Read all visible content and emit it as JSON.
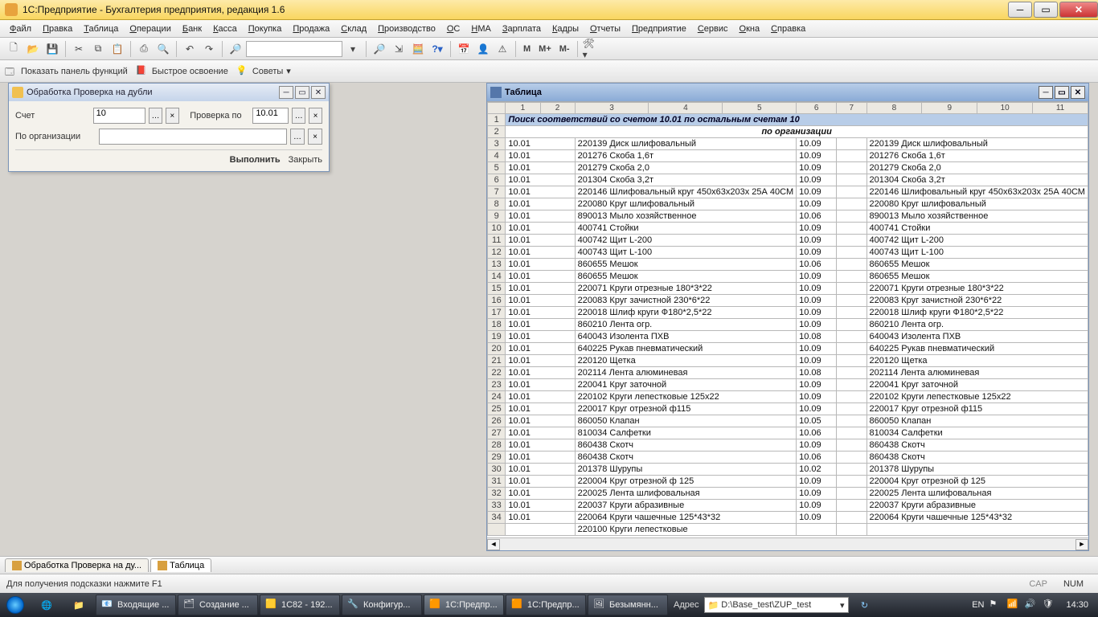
{
  "titlebar": {
    "title": "1С:Предприятие - Бухгалтерия предприятия, редакция 1.6"
  },
  "menu": [
    "Файл",
    "Правка",
    "Таблица",
    "Операции",
    "Банк",
    "Касса",
    "Покупка",
    "Продажа",
    "Склад",
    "Производство",
    "ОС",
    "НМА",
    "Зарплата",
    "Кадры",
    "Отчеты",
    "Предприятие",
    "Сервис",
    "Окна",
    "Справка"
  ],
  "toolbar2": {
    "panel": "Показать панель функций",
    "quick": "Быстрое освоение",
    "advice": "Советы"
  },
  "dialog": {
    "title": "Обработка  Проверка на дубли",
    "lbl_account": "Счет",
    "account": "10",
    "lbl_check": "Проверка по",
    "check": "10.01",
    "lbl_org": "По организации",
    "org": "",
    "btn_run": "Выполнить",
    "btn_close": "Закрыть"
  },
  "tablewin": {
    "title": "Таблица",
    "header_cols": [
      "1",
      "2",
      "3",
      "4",
      "5",
      "6",
      "7",
      "8",
      "9",
      "10",
      "11"
    ],
    "title_row": "Поиск соответствий со счетом 10.01 по остальным счетам 10",
    "org_row": "по организации",
    "rows": [
      [
        "3",
        "10.01",
        "220139 Диск шлифовальный",
        "10.09",
        "",
        "220139 Диск шлифовальный"
      ],
      [
        "4",
        "10.01",
        "201276 Скоба 1,6т",
        "10.09",
        "",
        "201276 Скоба 1,6т"
      ],
      [
        "5",
        "10.01",
        "201279 Скоба 2,0",
        "10.09",
        "",
        "201279 Скоба 2,0"
      ],
      [
        "6",
        "10.01",
        "201304 Скоба 3,2т",
        "10.09",
        "",
        "201304 Скоба 3,2т"
      ],
      [
        "7",
        "10.01",
        "220146 Шлифовальный круг 450х63х203х 25А 40СМ",
        "10.09",
        "",
        "220146 Шлифовальный круг 450х63х203х 25А 40СМ"
      ],
      [
        "8",
        "10.01",
        "220080 Круг шлифовальный",
        "10.09",
        "",
        "220080 Круг шлифовальный"
      ],
      [
        "9",
        "10.01",
        "890013 Мыло хозяйственное",
        "10.06",
        "",
        "890013 Мыло хозяйственное"
      ],
      [
        "10",
        "10.01",
        "400741 Стойки",
        "10.09",
        "",
        "400741 Стойки"
      ],
      [
        "11",
        "10.01",
        "400742 Щит L-200",
        "10.09",
        "",
        "400742 Щит L-200"
      ],
      [
        "12",
        "10.01",
        "400743 Щит L-100",
        "10.09",
        "",
        "400743 Щит L-100"
      ],
      [
        "13",
        "10.01",
        "860655 Мешок",
        "10.06",
        "",
        "860655 Мешок"
      ],
      [
        "14",
        "10.01",
        "860655 Мешок",
        "10.09",
        "",
        "860655 Мешок"
      ],
      [
        "15",
        "10.01",
        "220071 Круги отрезные 180*3*22",
        "10.09",
        "",
        "220071 Круги отрезные 180*3*22"
      ],
      [
        "16",
        "10.01",
        "220083 Круг зачистной 230*6*22",
        "10.09",
        "",
        "220083 Круг зачистной 230*6*22"
      ],
      [
        "17",
        "10.01",
        "220018 Шлиф круги Ф180*2,5*22",
        "10.09",
        "",
        "220018 Шлиф круги Ф180*2,5*22"
      ],
      [
        "18",
        "10.01",
        "860210 Лента огр.",
        "10.09",
        "",
        "860210 Лента огр."
      ],
      [
        "19",
        "10.01",
        "640043 Изолента  ПХВ",
        "10.08",
        "",
        "640043 Изолента  ПХВ"
      ],
      [
        "20",
        "10.01",
        "640225 Рукав пневматический",
        "10.09",
        "",
        "640225 Рукав пневматический"
      ],
      [
        "21",
        "10.01",
        "220120 Щетка",
        "10.09",
        "",
        "220120 Щетка"
      ],
      [
        "22",
        "10.01",
        "202114 Лента алюминевая",
        "10.08",
        "",
        "202114 Лента алюминевая"
      ],
      [
        "23",
        "10.01",
        "220041 Круг заточной",
        "10.09",
        "",
        "220041 Круг заточной"
      ],
      [
        "24",
        "10.01",
        "220102 Круги лепестковые 125х22",
        "10.09",
        "",
        "220102 Круги лепестковые 125х22"
      ],
      [
        "25",
        "10.01",
        "220017 Круг отрезной ф115",
        "10.09",
        "",
        "220017 Круг отрезной ф115"
      ],
      [
        "26",
        "10.01",
        "860050 Клапан",
        "10.05",
        "",
        "860050 Клапан"
      ],
      [
        "27",
        "10.01",
        "810034 Салфетки",
        "10.06",
        "",
        "810034 Салфетки"
      ],
      [
        "28",
        "10.01",
        "860438 Скотч",
        "10.09",
        "",
        "860438 Скотч"
      ],
      [
        "29",
        "10.01",
        "860438 Скотч",
        "10.06",
        "",
        "860438 Скотч"
      ],
      [
        "30",
        "10.01",
        "201378 Шурупы",
        "10.02",
        "",
        "201378 Шурупы"
      ],
      [
        "31",
        "10.01",
        "220004 Круг отрезной ф 125",
        "10.09",
        "",
        "220004 Круг отрезной ф 125"
      ],
      [
        "32",
        "10.01",
        "220025 Лента шлифовальная",
        "10.09",
        "",
        "220025 Лента шлифовальная"
      ],
      [
        "33",
        "10.01",
        "220037 Круги абразивные",
        "10.09",
        "",
        "220037 Круги абразивные"
      ],
      [
        "34",
        "10.01",
        "220064 Круги чашечные 125*43*32",
        "10.09",
        "",
        "220064 Круги чашечные 125*43*32"
      ],
      [
        "",
        "",
        "220100 Круги лепестковые",
        "",
        "",
        ""
      ]
    ]
  },
  "tabs": [
    {
      "label": "Обработка  Проверка на ду..."
    },
    {
      "label": "Таблица",
      "active": true
    }
  ],
  "statusbar": {
    "hint": "Для получения подсказки нажмите F1",
    "cap": "CAP",
    "num": "NUM"
  },
  "taskbar": {
    "tasks": [
      "Входящие ...",
      "Создание ...",
      "1С82 - 192...",
      "Конфигур...",
      "1С:Предпр...",
      "1С:Предпр...",
      "Безымянн..."
    ],
    "active_task": 4,
    "addr_label": "Адрес",
    "addr": "D:\\Base_test\\ZUP_test",
    "lang": "EN",
    "clock": "14:30"
  }
}
